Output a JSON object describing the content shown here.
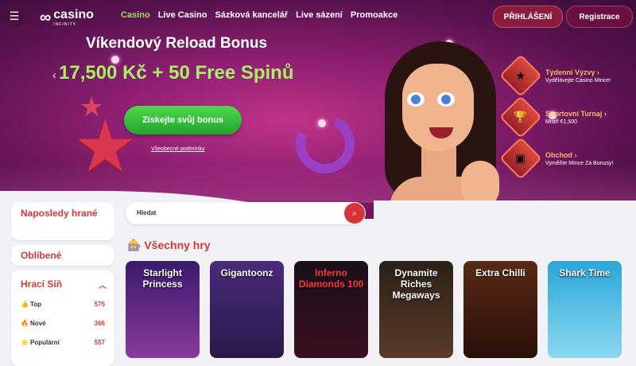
{
  "header": {
    "logo_text": "casino",
    "logo_sub": "INFINITY",
    "nav": [
      "Casino",
      "Live Casino",
      "Sázková kancelář",
      "Live sázení",
      "Promoakce"
    ],
    "login_label": "PŘIHLÁŠENÍ",
    "register_label": "Registrace"
  },
  "hero": {
    "title": "Víkendový Reload Bonus",
    "amount": "17,500 Kč + 50 Free Spinů",
    "cta_label": "Získejte svůj bonus",
    "terms_label": "Všeobecné podmínky"
  },
  "side_promos": [
    {
      "title": "Týdenní Výzvy",
      "subtitle": "Vydělávejte Casino Mince!"
    },
    {
      "title": "Sportovní Turnaj",
      "subtitle": "Mistři €1,500"
    },
    {
      "title": "Obchod",
      "subtitle": "Vyměňte Mince Za Bonusy!"
    }
  ],
  "sidebar": {
    "recent_label": "Naposledy hrané",
    "favorites_label": "Oblíbené",
    "lobby_label": "Hrací Síň",
    "items": [
      {
        "label": "Top",
        "count": "575"
      },
      {
        "label": "Nové",
        "count": "366"
      },
      {
        "label": "Populární",
        "count": "557"
      }
    ]
  },
  "search": {
    "placeholder": "Hledat"
  },
  "games": {
    "title": "Všechny hry",
    "tiles": [
      {
        "name": "Starlight Princess",
        "color": "#3a1a6e"
      },
      {
        "name": "Gigantoonz",
        "color": "#4a2a7a"
      },
      {
        "name": "Inferno Diamonds 100",
        "color": "#1a0f1a"
      },
      {
        "name": "Dynamite Riches Megaways",
        "color": "#2a2118"
      },
      {
        "name": "Extra Chilli",
        "color": "#5a2a18"
      },
      {
        "name": "Shark Time",
        "color": "#2aa6d8"
      }
    ]
  },
  "colors": {
    "accent_green": "#9be15d",
    "accent_red": "#d23a3a"
  }
}
